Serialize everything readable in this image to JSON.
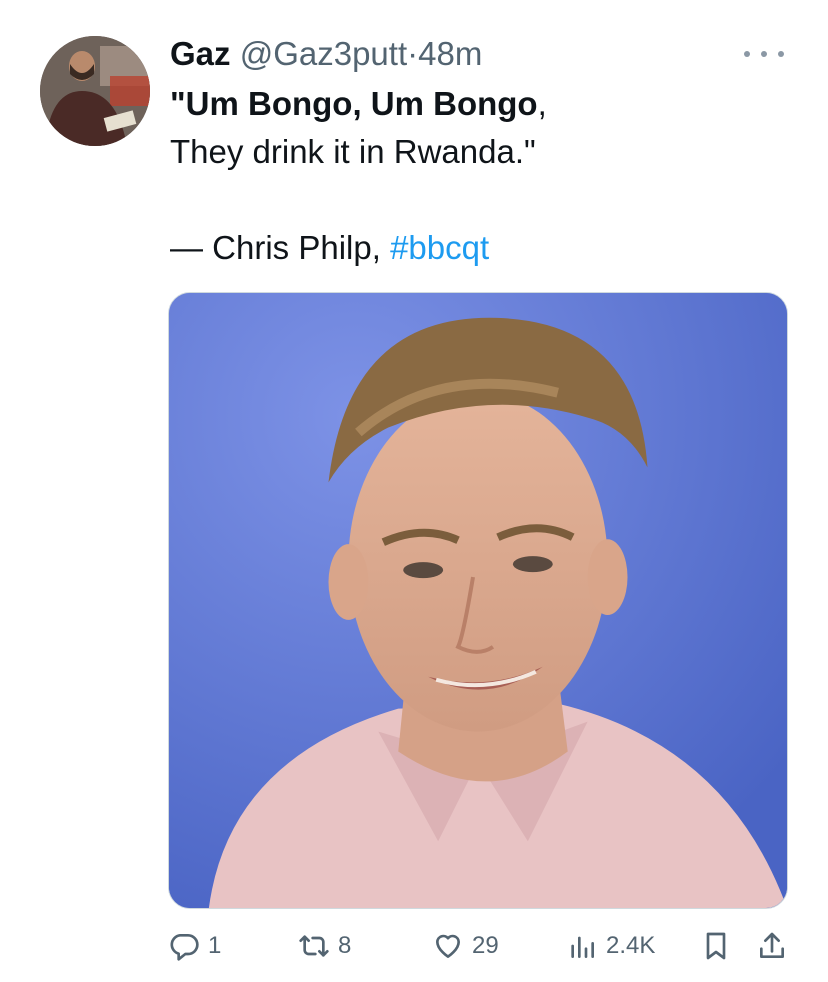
{
  "tweet": {
    "author_name": "Gaz",
    "author_handle": "@Gaz3putt",
    "separator": "·",
    "time": "48m",
    "text_line1_bold": "\"Um Bongo, Um Bongo",
    "text_line1_rest": ",",
    "text_line2": "They drink it in Rwanda.\"",
    "text_line3_prefix": "— Chris Philp, ",
    "hashtag": "#bbcqt"
  },
  "stats": {
    "replies": "1",
    "retweets": "8",
    "likes": "29",
    "views": "2.4K"
  },
  "icons": {
    "more": "more-icon",
    "reply": "reply-icon",
    "retweet": "retweet-icon",
    "like": "heart-icon",
    "views": "views-icon",
    "bookmark": "bookmark-icon",
    "share": "share-icon"
  },
  "colors": {
    "text": "#0f1419",
    "secondary": "#536471",
    "link": "#1d9bf0"
  }
}
